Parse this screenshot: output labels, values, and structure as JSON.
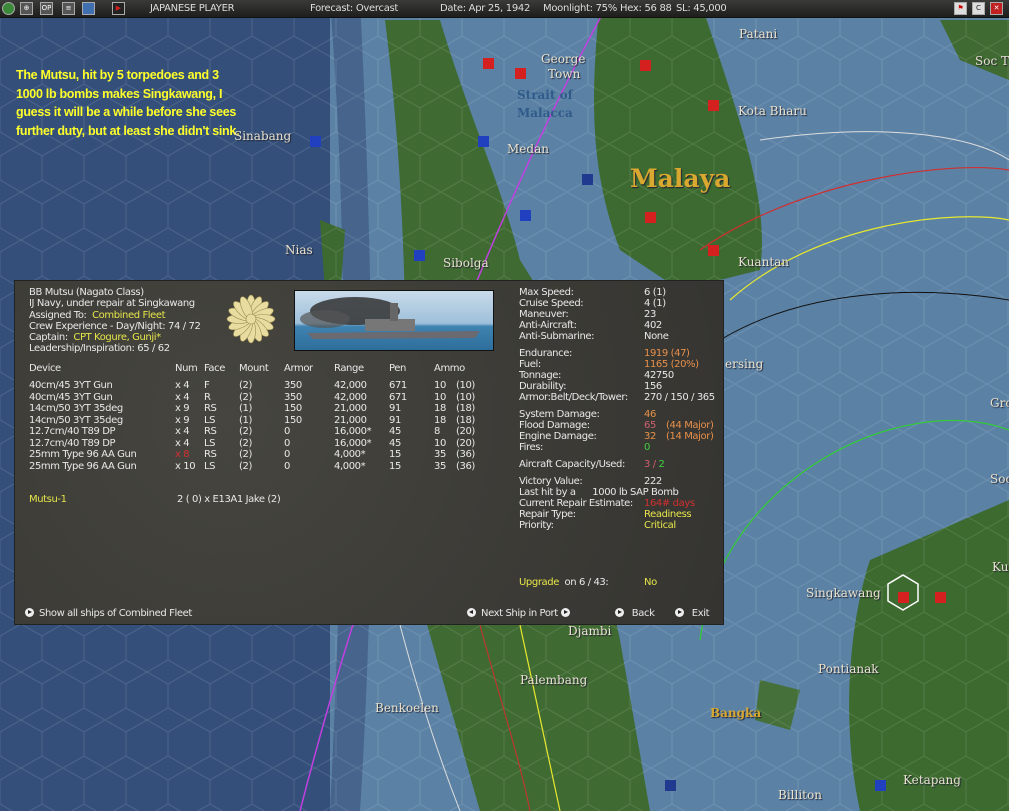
{
  "topbar": {
    "side": "JAPANESE PLAYER",
    "forecast": "Forecast: Overcast",
    "date": "Date: Apr 25, 1942",
    "moonlight": "Moonlight: 75%",
    "hex": "Hex: 56 88",
    "sl": "SL: 45,000",
    "icons": [
      "globe-icon",
      "map-icon",
      "op-icon",
      "list-icon",
      "window-icon",
      "flag-icon"
    ],
    "icon_op": "OP",
    "icon_c": "C"
  },
  "note": "The Mutsu, hit by 5 torpedoes and 3 1000 lb bombs makes Singkawang, I guess it will be a while before she sees further duty, but at least she didn't sink.",
  "map_labels": {
    "patani": "Patani",
    "soc_top": "Soc T",
    "george": "George",
    "town": "Town",
    "strait1": "Strait of",
    "strait2": "Malacca",
    "kota": "Kota Bharu",
    "sinabang": "Sinabang",
    "medan": "Medan",
    "malaya": "Malaya",
    "nias": "Nias",
    "sibolga": "Sibolga",
    "kuantan": "Kuantan",
    "mersing": "ersing",
    "gro": "Gro",
    "soc": "Soc",
    "ku": "Ku",
    "singkawang": "Singkawang",
    "pontianak": "Pontianak",
    "djambi": "Djambi",
    "palembang": "Palembang",
    "benkoelen": "Benkoelen",
    "bangka": "Bangka",
    "billiton": "Billiton",
    "ketapang": "Ketapang"
  },
  "ship": {
    "name": "BB Mutsu (Nagato Class)",
    "status": "IJ Navy, under repair at Singkawang",
    "assigned_label": "Assigned To:",
    "assigned": "Combined Fleet",
    "crew": "Crew Experience - Day/Night: 74 / 72",
    "captain_label": "Captain:",
    "captain": "CPT Kogure, Gunji*",
    "leadership": "Leadership/Inspiration: 65 / 62"
  },
  "devices": {
    "headers": [
      "Device",
      "Num",
      "Face",
      "Mount",
      "Armor",
      "Range",
      "Pen",
      "Ammo"
    ],
    "rows": [
      [
        "40cm/45 3YT Gun",
        "x 4",
        "F",
        "(2)",
        "350",
        "42,000",
        "671",
        "10",
        "(10)"
      ],
      [
        "40cm/45 3YT Gun",
        "x 4",
        "R",
        "(2)",
        "350",
        "42,000",
        "671",
        "10",
        "(10)"
      ],
      [
        "14cm/50 3YT 35deg",
        "x 9",
        "RS",
        "(1)",
        "150",
        "21,000",
        "91",
        "18",
        "(18)"
      ],
      [
        "14cm/50 3YT 35deg",
        "x 9",
        "LS",
        "(1)",
        "150",
        "21,000",
        "91",
        "18",
        "(18)"
      ],
      [
        "12.7cm/40 T89 DP",
        "x 4",
        "RS",
        "(2)",
        "0",
        "16,000*",
        "45",
        "8",
        "(20)"
      ],
      [
        "12.7cm/40 T89 DP",
        "x 4",
        "LS",
        "(2)",
        "0",
        "16,000*",
        "45",
        "10",
        "(20)"
      ],
      [
        "25mm Type 96 AA Gun",
        "x 8",
        "RS",
        "(2)",
        "0",
        "4,000*",
        "15",
        "35",
        "(36)"
      ],
      [
        "25mm Type 96 AA Gun",
        "x 10",
        "LS",
        "(2)",
        "0",
        "4,000*",
        "15",
        "35",
        "(36)"
      ]
    ],
    "damaged_row": 6
  },
  "air": {
    "group": "Mutsu-1",
    "aircraft": "2 ( 0) x E13A1 Jake (2)"
  },
  "stats": [
    {
      "l": "Max Speed:",
      "v": "6  (1)"
    },
    {
      "l": "Cruise Speed:",
      "v": "4  (1)"
    },
    {
      "l": "Maneuver:",
      "v": "23"
    },
    {
      "l": "Anti-Aircraft:",
      "v": "402"
    },
    {
      "l": "Anti-Submarine:",
      "v": "None"
    },
    {
      "l": "Endurance:",
      "v": "1919 (47)",
      "c": "o",
      "gap": 1
    },
    {
      "l": "Fuel:",
      "v": "1165 (20%)",
      "c": "o"
    },
    {
      "l": "Tonnage:",
      "v": "42750"
    },
    {
      "l": "Durability:",
      "v": "156"
    },
    {
      "l": "Armor:Belt/Deck/Tower:",
      "v": "270 / 150 / 365"
    },
    {
      "l": "System Damage:",
      "v": "46",
      "c": "o",
      "gap": 1
    },
    {
      "l": "Flood Damage:",
      "v": "65",
      "c": "pk",
      "v2": "(44 Major)"
    },
    {
      "l": "Engine Damage:",
      "v": "32",
      "c": "o",
      "v2": "(14 Major)"
    },
    {
      "l": "Fires:",
      "v": "0",
      "c": "g"
    }
  ],
  "aircraft_capacity": {
    "l": "Aircraft Capacity/Used:",
    "cap": "3",
    "used": "2"
  },
  "victory": {
    "l": "Victory Value:",
    "v": "222"
  },
  "last_hit": {
    "l": "Last hit by a",
    "v": "1000 lb SAP Bomb"
  },
  "repair_est": {
    "l": "Current Repair Estimate:",
    "v": "164# days"
  },
  "repair_type": {
    "l": "Repair Type:",
    "v": "Readiness"
  },
  "priority": {
    "l": "Priority:",
    "v": "Critical"
  },
  "upgrade": {
    "label": "Upgrade",
    "on": "on 6 / 43:",
    "v": "No"
  },
  "buttons": {
    "show_all": "Show all ships of Combined Fleet",
    "next": "Next Ship in Port",
    "back": "Back",
    "exit": "Exit"
  }
}
